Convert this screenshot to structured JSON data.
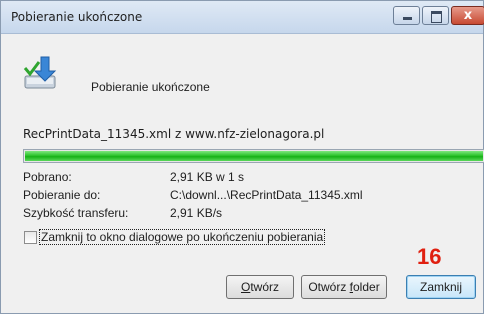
{
  "window": {
    "title": "Pobieranie ukończone",
    "close_glyph": "x"
  },
  "dialog": {
    "heading": "Pobieranie ukończone",
    "icon": "download-complete-icon",
    "filename": "RecPrintData_11345.xml z www.nfz-zielonagora.pl",
    "progress_fraction": 1.0,
    "progress_color": "#22bb22"
  },
  "info": {
    "downloaded_label": "Pobrano:",
    "downloaded_value": "2,91 KB w 1 s",
    "destination_label": "Pobieranie do:",
    "destination_value": "C:\\downl...\\RecPrintData_11345.xml",
    "speed_label": "Szybkość transferu:",
    "speed_value": "2,91 KB/s"
  },
  "checkbox": {
    "label": "Zamknij to okno dialogowe po ukończeniu pobierania",
    "checked": false
  },
  "annotation": {
    "text": "16",
    "color": "#e02010"
  },
  "buttons": {
    "open_label": "Otwórz",
    "open_folder_label": "Otwórz folder",
    "close_label": "Zamknij"
  }
}
